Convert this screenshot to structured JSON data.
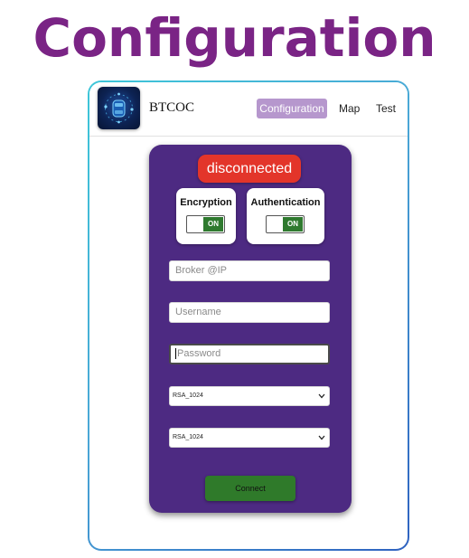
{
  "page": {
    "title": "Configuration"
  },
  "navbar": {
    "brand": "BTCOC",
    "items": [
      {
        "label": "Configuration",
        "active": true
      },
      {
        "label": "Map",
        "active": false
      },
      {
        "label": "Test",
        "active": false
      }
    ]
  },
  "status": {
    "text": "disconnected",
    "color": "#e3352a"
  },
  "toggles": {
    "encryption": {
      "label": "Encryption",
      "state": "ON"
    },
    "authentication": {
      "label": "Authentication",
      "state": "ON"
    }
  },
  "form": {
    "broker_placeholder": "Broker @IP",
    "username_placeholder": "Username",
    "password_placeholder": "Password",
    "select1_value": "RSA_1024",
    "select2_value": "RSA_1024",
    "connect_label": "Connect"
  },
  "colors": {
    "title": "#7a2485",
    "card": "#4d2a82",
    "active_nav": "#b697cd",
    "toggle_on": "#2f7a2f",
    "connect": "#2f7a2a"
  },
  "icons": {
    "logo": "car-network-logo-icon",
    "select_chevron": "chevron-down-icon"
  }
}
